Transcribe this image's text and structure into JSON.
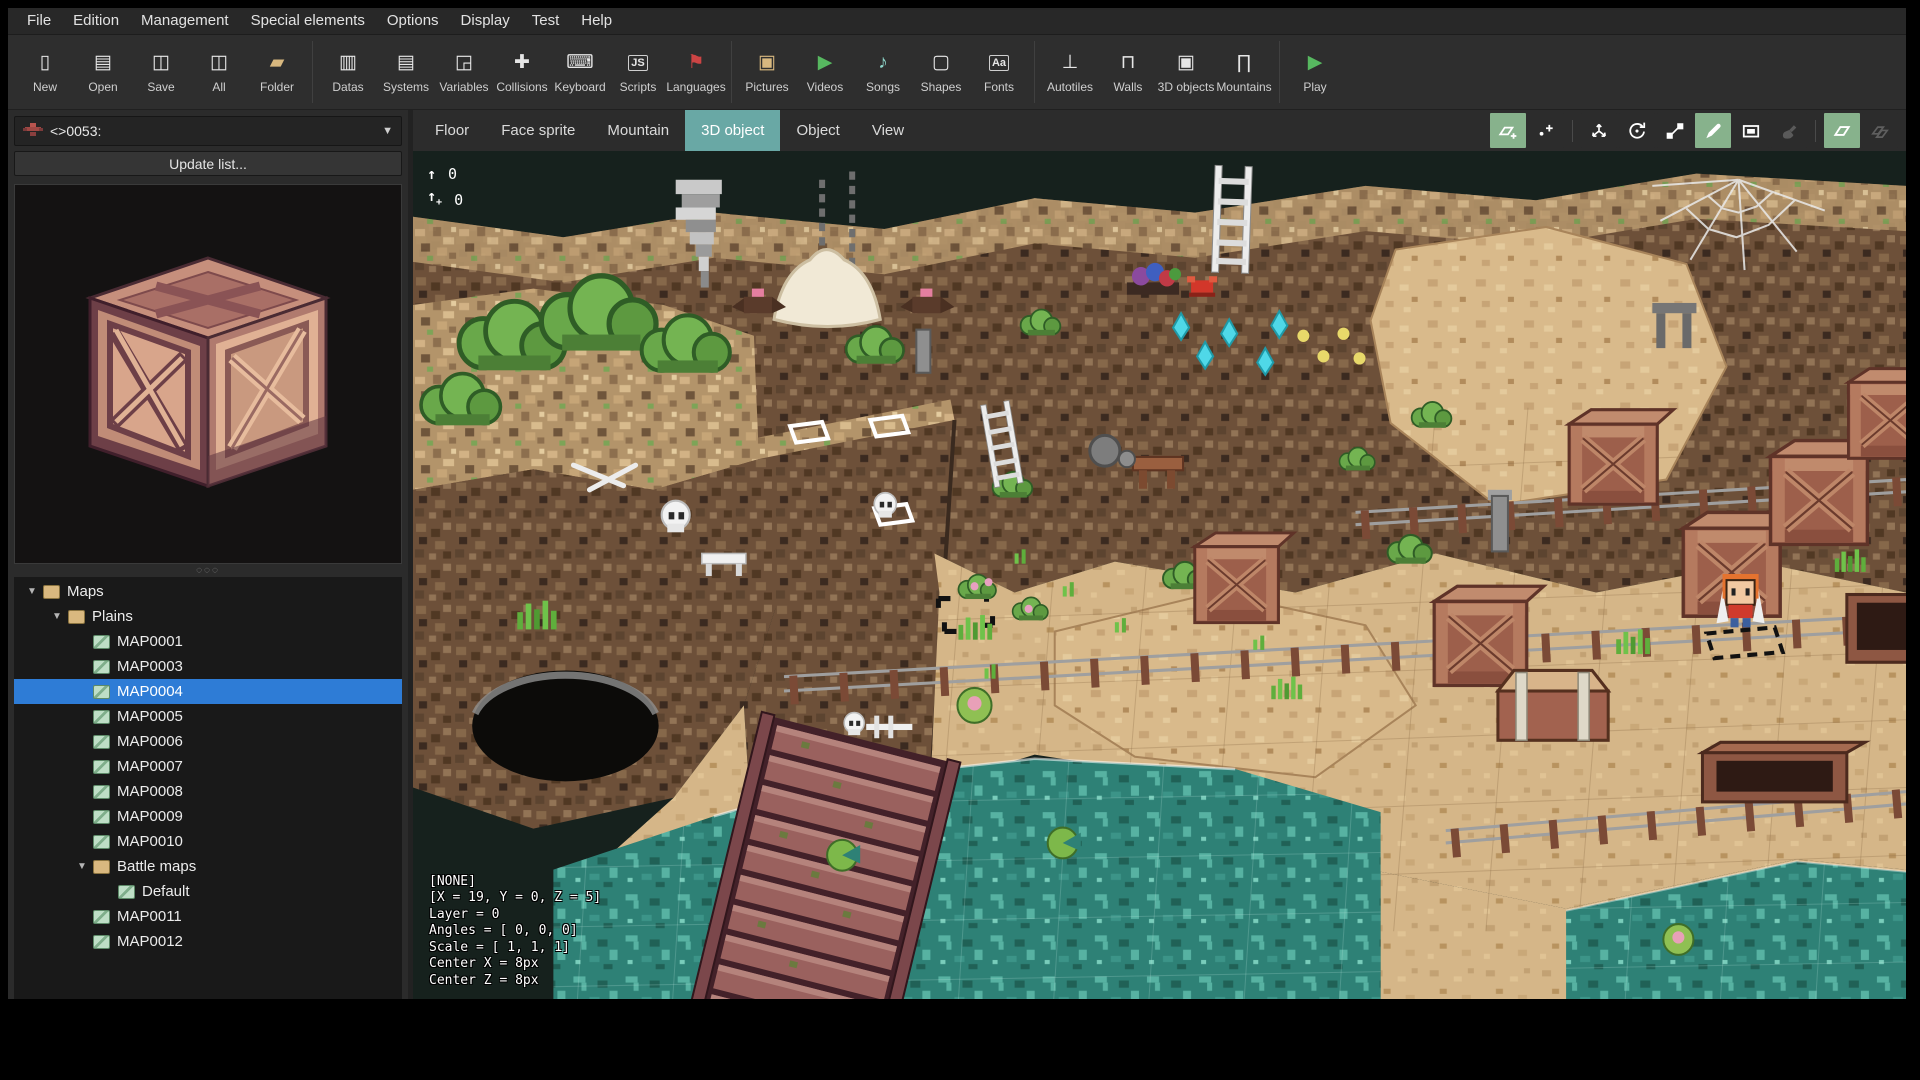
{
  "menu_bar": {
    "items": [
      "File",
      "Edition",
      "Management",
      "Special elements",
      "Options",
      "Display",
      "Test",
      "Help"
    ]
  },
  "toolbar": {
    "groups": [
      {
        "items": [
          {
            "label": "New",
            "icon": "new-file-icon"
          },
          {
            "label": "Open",
            "icon": "open-file-icon"
          },
          {
            "label": "Save",
            "icon": "save-icon"
          },
          {
            "label": "All",
            "icon": "save-all-icon"
          },
          {
            "label": "Folder",
            "icon": "folder-icon"
          }
        ]
      },
      {
        "items": [
          {
            "label": "Datas",
            "icon": "datas-icon"
          },
          {
            "label": "Systems",
            "icon": "systems-icon"
          },
          {
            "label": "Variables",
            "icon": "variables-icon"
          },
          {
            "label": "Collisions",
            "icon": "collisions-icon"
          },
          {
            "label": "Keyboard",
            "icon": "keyboard-icon"
          },
          {
            "label": "Scripts",
            "icon": "scripts-icon"
          },
          {
            "label": "Languages",
            "icon": "languages-icon"
          }
        ]
      },
      {
        "items": [
          {
            "label": "Pictures",
            "icon": "pictures-icon"
          },
          {
            "label": "Videos",
            "icon": "videos-icon"
          },
          {
            "label": "Songs",
            "icon": "songs-icon"
          },
          {
            "label": "Shapes",
            "icon": "shapes-icon"
          },
          {
            "label": "Fonts",
            "icon": "fonts-icon"
          }
        ]
      },
      {
        "items": [
          {
            "label": "Autotiles",
            "icon": "autotiles-icon"
          },
          {
            "label": "Walls",
            "icon": "walls-icon"
          },
          {
            "label": "3D objects",
            "icon": "objects3d-icon"
          },
          {
            "label": "Mountains",
            "icon": "mountains-icon"
          }
        ]
      },
      {
        "items": [
          {
            "label": "Play",
            "icon": "play-icon"
          }
        ]
      }
    ]
  },
  "left_panel": {
    "object_selector": {
      "value": "<>0053:",
      "icon": "object-sprite-icon"
    },
    "update_button_label": "Update list...",
    "preview_object": "wooden-crate-3d-preview"
  },
  "map_tree": {
    "items": [
      {
        "label": "Maps",
        "level": 0,
        "type": "folder",
        "caret": true,
        "selected": false
      },
      {
        "label": "Plains",
        "level": 1,
        "type": "folder",
        "caret": true,
        "selected": false
      },
      {
        "label": "MAP0001",
        "level": 2,
        "type": "map",
        "caret": false,
        "selected": false
      },
      {
        "label": "MAP0003",
        "level": 2,
        "type": "map",
        "caret": false,
        "selected": false
      },
      {
        "label": "MAP0004",
        "level": 2,
        "type": "map",
        "caret": false,
        "selected": true
      },
      {
        "label": "MAP0005",
        "level": 2,
        "type": "map",
        "caret": false,
        "selected": false
      },
      {
        "label": "MAP0006",
        "level": 2,
        "type": "map",
        "caret": false,
        "selected": false
      },
      {
        "label": "MAP0007",
        "level": 2,
        "type": "map",
        "caret": false,
        "selected": false
      },
      {
        "label": "MAP0008",
        "level": 2,
        "type": "map",
        "caret": false,
        "selected": false
      },
      {
        "label": "MAP0009",
        "level": 2,
        "type": "map",
        "caret": false,
        "selected": false
      },
      {
        "label": "MAP0010",
        "level": 2,
        "type": "map",
        "caret": false,
        "selected": false
      },
      {
        "label": "Battle maps",
        "level": 2,
        "type": "folder",
        "caret": true,
        "selected": false
      },
      {
        "label": "Default",
        "level": 3,
        "type": "map",
        "caret": false,
        "selected": false
      },
      {
        "label": "MAP0011",
        "level": 2,
        "type": "map",
        "caret": false,
        "selected": false
      },
      {
        "label": "MAP0012",
        "level": 2,
        "type": "map",
        "caret": false,
        "selected": false
      }
    ]
  },
  "editor": {
    "tabs": [
      {
        "label": "Floor",
        "selected": false
      },
      {
        "label": "Face sprite",
        "selected": false
      },
      {
        "label": "Mountain",
        "selected": false
      },
      {
        "label": "3D object",
        "selected": true
      },
      {
        "label": "Object",
        "selected": false
      },
      {
        "label": "View",
        "selected": false
      }
    ],
    "tools": [
      {
        "type": "button",
        "name": "add-land-tool",
        "icon": "plane-plus-icon",
        "active": true,
        "disabled": false
      },
      {
        "type": "button",
        "name": "add-point-tool",
        "icon": "dot-plus-icon",
        "active": false,
        "disabled": false
      },
      {
        "type": "separator"
      },
      {
        "type": "button",
        "name": "translate-tool",
        "icon": "translate-icon",
        "active": false,
        "disabled": false
      },
      {
        "type": "button",
        "name": "rotate-tool",
        "icon": "rotate-icon",
        "active": false,
        "disabled": false
      },
      {
        "type": "button",
        "name": "scale-tool",
        "icon": "scale-icon",
        "active": false,
        "disabled": false
      },
      {
        "type": "button",
        "name": "pencil-tool",
        "icon": "pencil-icon",
        "active": true,
        "disabled": false
      },
      {
        "type": "button",
        "name": "rectangle-tool",
        "icon": "rectangle-icon",
        "active": false,
        "disabled": false
      },
      {
        "type": "button",
        "name": "paint-tool",
        "icon": "paint-icon",
        "active": false,
        "disabled": true
      },
      {
        "type": "separator"
      },
      {
        "type": "button",
        "name": "plane-mode-tool",
        "icon": "plane-icon",
        "active": true,
        "disabled": false
      },
      {
        "type": "button",
        "name": "layers-tool",
        "icon": "layers-icon",
        "active": false,
        "disabled": true
      }
    ]
  },
  "map_overlay": {
    "height_square": "0",
    "height_pixel": "0",
    "info_lines": [
      "[NONE]",
      "[X = 19, Y = 0, Z = 5]",
      "Layer = 0",
      "Angles = [ 0, 0, 0]",
      "Scale = [ 1, 1, 1]",
      "Center X = 8px",
      "Center Z = 8px"
    ]
  },
  "colors": {
    "tab_active": "#69a8a5",
    "tool_active": "#87b28c",
    "tree_selection": "#2e7cd6",
    "map_sky": "#16211d",
    "play_green": "#57b860"
  }
}
